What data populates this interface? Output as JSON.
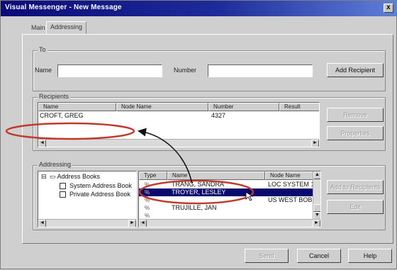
{
  "window": {
    "title": "Visual Messenger - New Message",
    "close_glyph": "x"
  },
  "tabs": [
    {
      "label": "Main"
    },
    {
      "label": "Addressing"
    }
  ],
  "to": {
    "group_label": "To",
    "name_label": "Name",
    "name_value": "",
    "number_label": "Number",
    "number_value": "",
    "add_button": "Add Recipient"
  },
  "recipients": {
    "group_label": "Recipients",
    "columns": [
      "Name",
      "Node Name",
      "Number",
      "Result"
    ],
    "rows": [
      {
        "name": "CROFT, GREG",
        "node": "",
        "number": "4327",
        "result": ""
      }
    ],
    "remove_button": "Remove",
    "properties_button": "Properties"
  },
  "addressing": {
    "group_label": "Addressing",
    "tree": {
      "root": "Address Books",
      "children": [
        "System Address Book",
        "Private Address Book"
      ]
    },
    "columns": [
      "Type",
      "Name",
      "Node Name"
    ],
    "entries": [
      {
        "type": "%",
        "name": "TRANG, SANDRA",
        "node": "LOC SYSTEM 1",
        "selected": false
      },
      {
        "type": "%",
        "name": "TROYER, LESLEY",
        "node": "",
        "selected": true
      },
      {
        "type": "%",
        "name": "",
        "node": "US WEST BOB",
        "selected": false
      },
      {
        "type": "%",
        "name": "TRUJILLE, JAN",
        "node": "",
        "selected": false
      },
      {
        "type": "%",
        "name": "",
        "node": "",
        "selected": false
      }
    ],
    "add_to_recipients_button": "Add to Recipients",
    "edit_button": "Edit"
  },
  "footer": {
    "send_button": "Send",
    "cancel_button": "Cancel",
    "help_button": "Help"
  },
  "colors": {
    "title_bar": "#0b0b7a",
    "selection": "#0a0a6e",
    "annotation": "#c0392b"
  }
}
